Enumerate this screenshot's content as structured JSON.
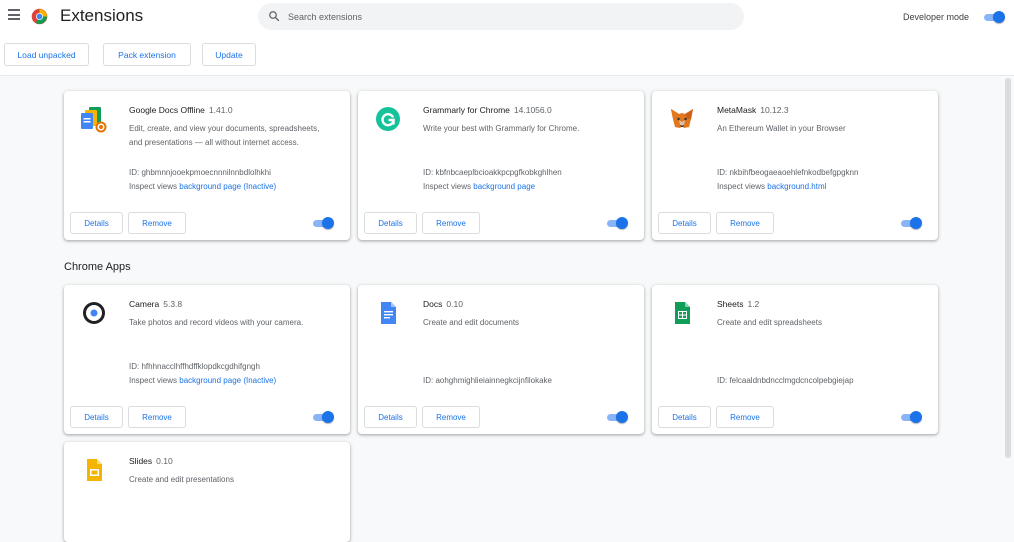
{
  "header": {
    "title": "Extensions",
    "search_placeholder": "Search extensions",
    "developer_mode_label": "Developer mode",
    "developer_mode_on": true
  },
  "toolbar": {
    "load_unpacked": "Load unpacked",
    "pack_extension": "Pack extension",
    "update": "Update"
  },
  "labels": {
    "details": "Details",
    "remove": "Remove",
    "inspect_views": "Inspect views"
  },
  "extensions": [
    {
      "icon": "google-docs-offline-icon",
      "name": "Google Docs Offline",
      "version": "1.41.0",
      "description": "Edit, create, and view your documents, spreadsheets, and presentations — all without internet access.",
      "id": "ID: ghbmnnjooekpmoecnnnilnnbdlolhkhi",
      "inspect_link": "background page (Inactive)",
      "enabled": true
    },
    {
      "icon": "grammarly-icon",
      "name": "Grammarly for Chrome",
      "version": "14.1056.0",
      "description": "Write your best with Grammarly for Chrome.",
      "id": "ID: kbfnbcaeplbcioakkpcpgfkobkghlhen",
      "inspect_link": "background page",
      "enabled": true
    },
    {
      "icon": "metamask-fox-icon",
      "name": "MetaMask",
      "version": "10.12.3",
      "description": "An Ethereum Wallet in your Browser",
      "id": "ID: nkbihfbeogaeaoehlefnkodbefgpgknn",
      "inspect_link": "background.html",
      "enabled": true
    }
  ],
  "apps_section_title": "Chrome Apps",
  "apps": [
    {
      "icon": "camera-icon",
      "name": "Camera",
      "version": "5.3.8",
      "description": "Take photos and record videos with your camera.",
      "id": "ID: hfhhnacclhffhdffklopdkcgdhifgngh",
      "inspect_link": "background page (Inactive)",
      "enabled": true
    },
    {
      "icon": "docs-icon",
      "name": "Docs",
      "version": "0.10",
      "description": "Create and edit documents",
      "id": "ID: aohghmighlieiainnegkcijnfilokake",
      "enabled": true
    },
    {
      "icon": "sheets-icon",
      "name": "Sheets",
      "version": "1.2",
      "description": "Create and edit spreadsheets",
      "id": "ID: felcaaldnbdncclmgdcncolpebgiejap",
      "enabled": true
    },
    {
      "icon": "slides-icon",
      "name": "Slides",
      "version": "0.10",
      "description": "Create and edit presentations"
    }
  ]
}
